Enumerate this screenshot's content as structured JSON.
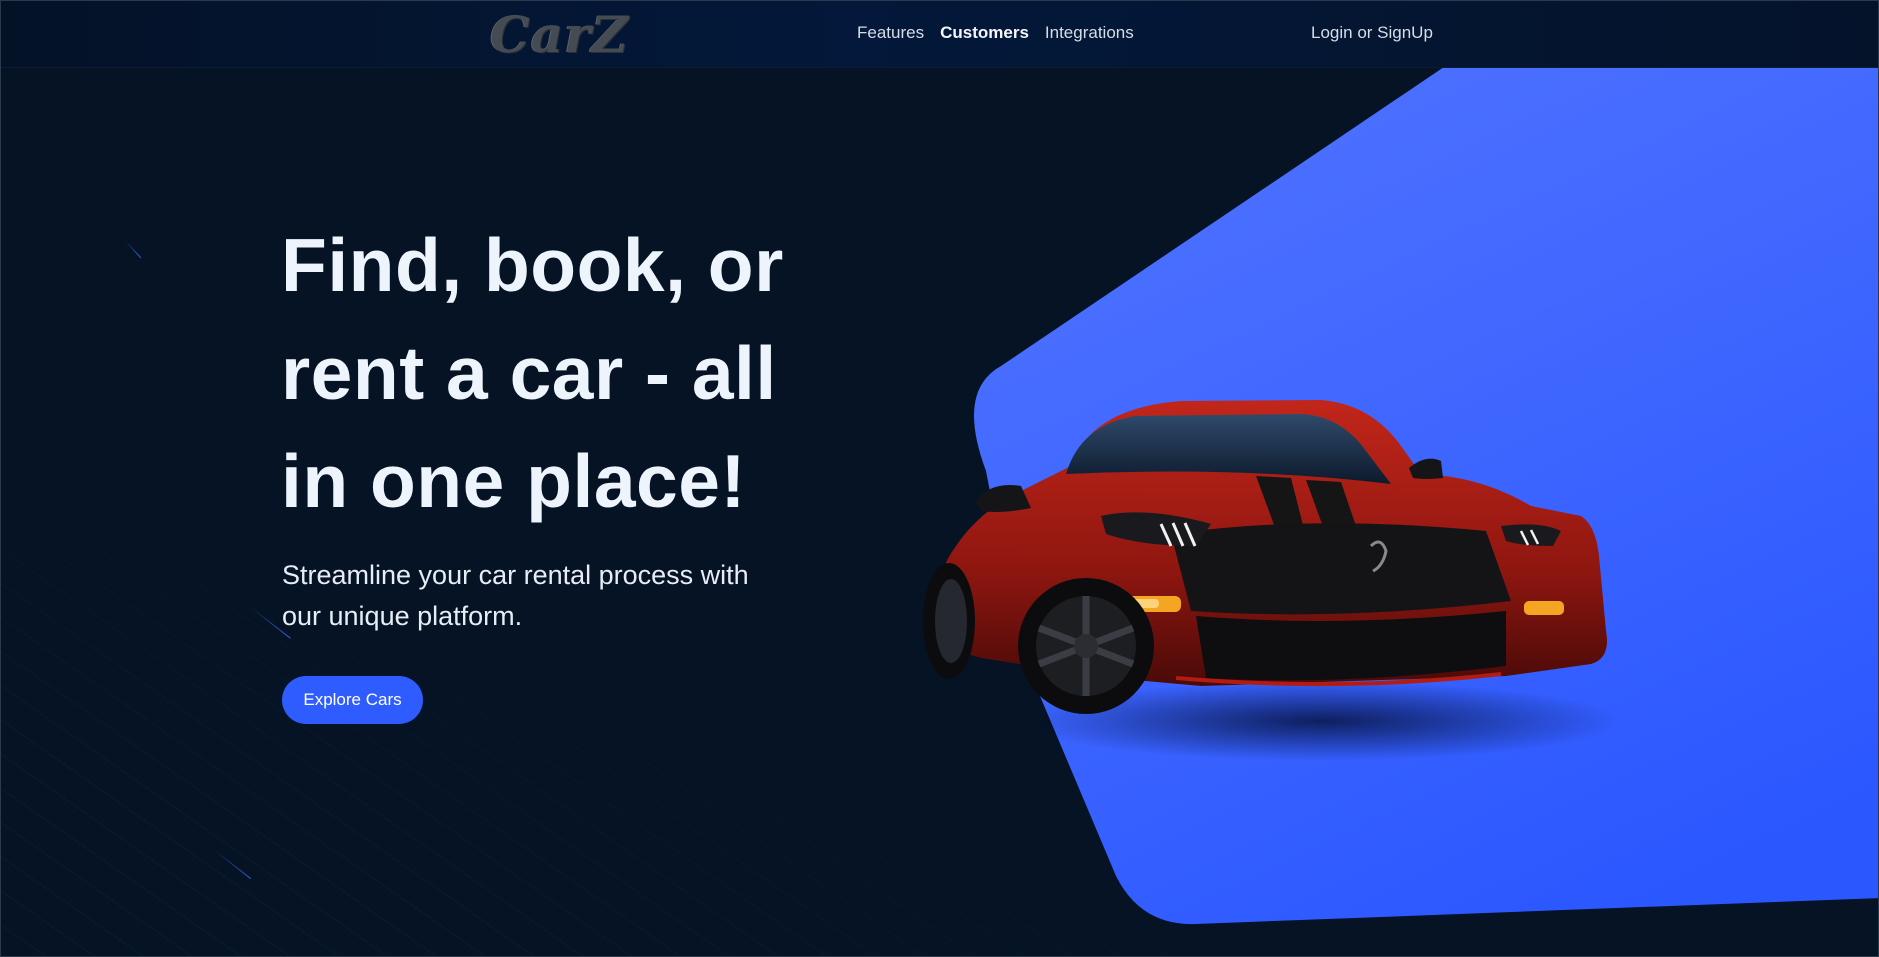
{
  "header": {
    "logo_text": "CarZ",
    "nav": [
      {
        "label": "Features"
      },
      {
        "label": "Customers",
        "active": true
      },
      {
        "label": "Integrations"
      }
    ],
    "auth_label": "Login or SignUp"
  },
  "hero": {
    "title": "Find, book, or rent a car - all in one place!",
    "subtitle": "Streamline your car rental process with our unique platform.",
    "cta_label": "Explore Cars"
  },
  "hero_image": {
    "icon": "sports-car-image",
    "car_colors": {
      "body": "#9e1a12",
      "stripe": "#121212"
    }
  },
  "colors": {
    "background": "#051325",
    "accent": "#2f5cff",
    "panel_gradient_top": "#4f73ff",
    "panel_gradient_bottom": "#2b57ff",
    "text": "#eef4fb"
  }
}
